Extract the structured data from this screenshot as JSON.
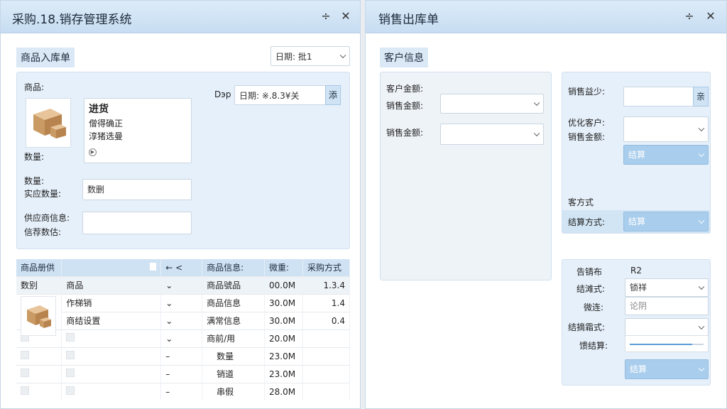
{
  "left_window": {
    "title": "采购.18.销存管理系统",
    "pin_icon": "pin-icon",
    "close_icon": "close-icon",
    "section_title": "商品入库单",
    "date_selector": {
      "prefix": "日期:",
      "value": "批1"
    },
    "form": {
      "product_label": "商品:",
      "card": {
        "title": "进货",
        "line1": "僧得确正",
        "line2": "淳猪选曼",
        "play_icon": "play-icon"
      },
      "qty_label": "数量:",
      "date_prefix": "Dэр",
      "date_field_value": "日期: ※.8.3¥关",
      "date_button": "添",
      "qty2_label": "数量:",
      "supply_qty_label": "实应数量:",
      "supply_qty_placeholder": "数删",
      "supplier_label": "供应商信息:",
      "supplier_sub_label": "信荐数估:"
    },
    "table": {
      "headers": [
        "商品册供",
        "​",
        "← <",
        "商品信息:",
        "微重:",
        "采购方式"
      ],
      "rows": [
        [
          "数别",
          "商品",
          "⌄",
          "商品號品",
          "00.0M",
          "1.3.4"
        ],
        [
          "",
          "作梯销",
          "⌄",
          "商品信息",
          "30.0M",
          "1.4"
        ],
        [
          "",
          "商结设置",
          "⌄",
          "满常信息",
          "30.0M",
          "0.4"
        ],
        [
          "",
          "",
          "⌄",
          "商前/用",
          "20.0M",
          ""
        ],
        [
          "",
          "",
          "–",
          "数量",
          "23.0M",
          ""
        ],
        [
          "",
          "",
          "–",
          "销道",
          "23.0M",
          ""
        ],
        [
          "",
          "",
          "–",
          "串假",
          "28.0M",
          ""
        ]
      ]
    }
  },
  "right_window": {
    "title": "销售出库单",
    "pin_icon": "pin-icon",
    "close_icon": "close-icon",
    "section_title": "客户信息",
    "customer": {
      "amount_label_1": "客户金额:",
      "amount_label_2": "销售金额:",
      "amount_label_3": "销售金额:"
    },
    "sales": {
      "sales_label": "销售益少:",
      "sales_button": "亲",
      "preferred_customer_label": "优化客户:",
      "sales_amount_label": "销售金额:",
      "settle_button": "结算",
      "customer_mode_label": "客方式",
      "settle_mode_label": "结算方式:",
      "settle_mode_value": "结算"
    },
    "summary": {
      "label1": "告锖布",
      "value1": "R2",
      "label2": "结滩式:",
      "value2": "锁祥",
      "label3": "微连:",
      "value3_placeholder": "论阴",
      "label4": "结摘霜式:",
      "label5": "馈结算:",
      "slider_level": 0.85,
      "settle_button": "结算"
    }
  }
}
